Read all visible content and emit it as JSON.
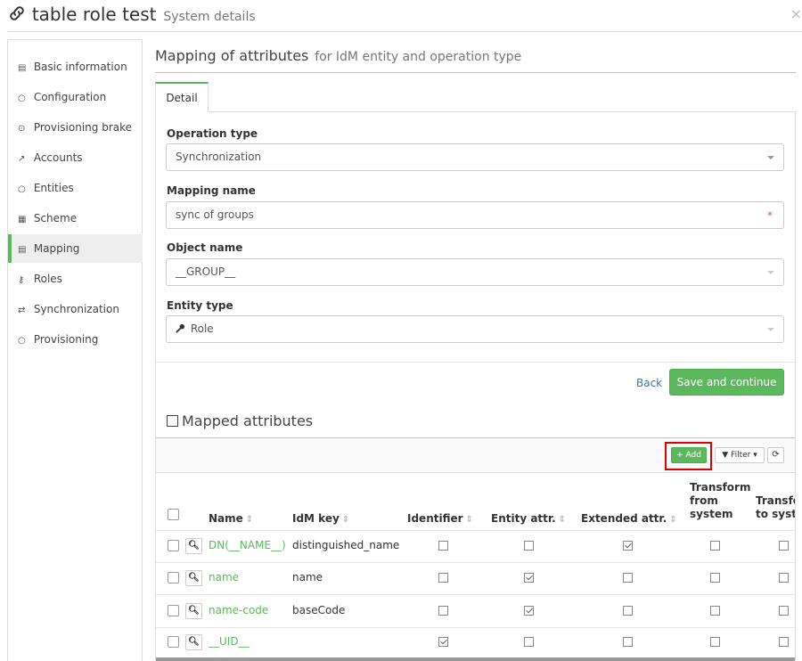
{
  "header": {
    "title": "table role test",
    "subtitle": "System details",
    "close": "×"
  },
  "sidebar": {
    "items": [
      {
        "icon": "▤",
        "label": "Basic information"
      },
      {
        "icon": "○",
        "label": "Configuration"
      },
      {
        "icon": "⊙",
        "label": "Provisioning brake"
      },
      {
        "icon": "↗",
        "label": "Accounts"
      },
      {
        "icon": "○",
        "label": "Entities"
      },
      {
        "icon": "▦",
        "label": "Scheme"
      },
      {
        "icon": "▤",
        "label": "Mapping"
      },
      {
        "icon": "⚷",
        "label": "Roles"
      },
      {
        "icon": "⇄",
        "label": "Synchronization"
      },
      {
        "icon": "○",
        "label": "Provisioning"
      }
    ]
  },
  "main": {
    "title": "Mapping of attributes",
    "subtitle": "for IdM entity and operation type",
    "tab": "Detail",
    "form": {
      "operation_type_label": "Operation type",
      "operation_type_value": "Synchronization",
      "mapping_name_label": "Mapping name",
      "mapping_name_value": "sync of groups",
      "required_mark": "*",
      "object_name_label": "Object name",
      "object_name_value": "__GROUP__",
      "entity_type_label": "Entity type",
      "entity_type_value": "Role"
    },
    "actions": {
      "back": "Back",
      "save": "Save and continue"
    }
  },
  "mapped": {
    "title": "Mapped attributes",
    "toolbar": {
      "add": "+ Add",
      "filter": "Filter",
      "refresh": "⟳"
    },
    "columns": {
      "name": "Name",
      "idm_key": "IdM key",
      "identifier": "Identifier",
      "entity_attr": "Entity attr.",
      "extended_attr": "Extended attr.",
      "transform_from_1": "Transform",
      "transform_from_2": "from",
      "transform_from_3": "system",
      "transform_to_1": "Transform",
      "transform_to_2": "to system"
    },
    "rows": [
      {
        "name": "DN(__NAME__)",
        "idm_key": "distinguished_name",
        "identifier": false,
        "entity": false,
        "extended": true,
        "from": false,
        "to": false
      },
      {
        "name": "name",
        "idm_key": "name",
        "identifier": false,
        "entity": true,
        "extended": false,
        "from": false,
        "to": false
      },
      {
        "name": "name-code",
        "idm_key": "baseCode",
        "identifier": false,
        "entity": true,
        "extended": false,
        "from": false,
        "to": false
      },
      {
        "name": "__UID__",
        "idm_key": "",
        "identifier": true,
        "entity": false,
        "extended": false,
        "from": false,
        "to": false
      }
    ]
  },
  "colors": {
    "accent": "#5cb85c",
    "link": "#337ab7",
    "highlight": "#e00000"
  }
}
